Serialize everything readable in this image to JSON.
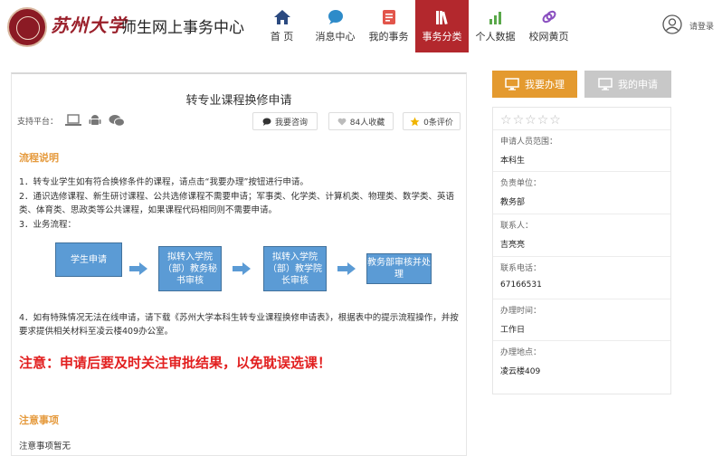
{
  "header": {
    "university": "苏州大学",
    "system_name": "师生网上事务中心",
    "nav": [
      {
        "label": "首 页",
        "icon": "home-icon",
        "active": false
      },
      {
        "label": "消息中心",
        "icon": "chat-icon",
        "active": false
      },
      {
        "label": "我的事务",
        "icon": "document-icon",
        "active": false
      },
      {
        "label": "事务分类",
        "icon": "books-icon",
        "active": true
      },
      {
        "label": "个人数据",
        "icon": "bar-chart-icon",
        "active": false
      },
      {
        "label": "校网黄页",
        "icon": "link-icon",
        "active": false
      }
    ],
    "login": "请登录"
  },
  "main": {
    "title": "转专业课程换修申请",
    "support_label": "支持平台：",
    "consult": "我要咨询",
    "favorites": "84人收藏",
    "reviews": "0条评价",
    "process_title": "流程说明",
    "steps": [
      "1．转专业学生如有符合换修条件的课程，请点击“我要办理”按钮进行申请。",
      "2．通识选修课程、新生研讨课程、公共选修课程不需要申请；军事类、化学类、计算机类、物理类、数学类、英语类、体育类、思政类等公共课程，如果课程代码相同则不需要申请。",
      "3．业务流程："
    ],
    "flow": [
      "学生申请",
      "拟转入学院（部）教务秘书审核",
      "拟转入学院（部）教学院长审核",
      "教务部审核并处理"
    ],
    "step4": "4．如有特殊情况无法在线申请，请下载《苏州大学本科生转专业课程换修申请表》，根据表中的提示流程操作，并按要求提供相关材料至凌云楼409办公室。",
    "notice": "注意：申请后要及时关注审批结果，以免耽误选课！",
    "attention_title": "注意事项",
    "attention_text": "注意事项暂无"
  },
  "side": {
    "do_button": "我要办理",
    "apply_button": "我的申请",
    "rating": 0,
    "fields": [
      {
        "label": "申请人员范围：",
        "value": "本科生"
      },
      {
        "label": "负责单位：",
        "value": "教务部"
      },
      {
        "label": "联系人：",
        "value": "吉亮亮"
      },
      {
        "label": "联系电话：",
        "value": "67166531"
      },
      {
        "label": "办理时间：",
        "value": "工作日"
      },
      {
        "label": "办理地点：",
        "value": "凌云楼409"
      }
    ]
  },
  "colors": {
    "brand_red": "#b3282d",
    "accent_orange": "#e49a2f",
    "flow_blue": "#5b9bd5",
    "notice_red": "#e21f1f"
  }
}
